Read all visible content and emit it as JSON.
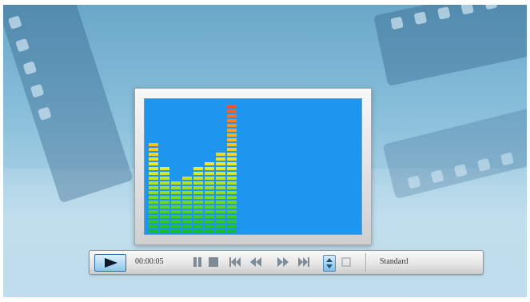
{
  "player": {
    "time": "00:00:05",
    "mode_label": "Standard"
  },
  "controls": [
    {
      "name": "play-button",
      "icon": "play-icon"
    },
    {
      "name": "pause-button",
      "icon": "pause-icon"
    },
    {
      "name": "stop-button",
      "icon": "stop-icon"
    },
    {
      "name": "previous-button",
      "icon": "skip-back-icon"
    },
    {
      "name": "rewind-button",
      "icon": "rewind-icon"
    },
    {
      "name": "fast-forward-button",
      "icon": "fast-forward-icon"
    },
    {
      "name": "next-button",
      "icon": "skip-forward-icon"
    },
    {
      "name": "volume-button",
      "icon": "volume-updown-icon"
    },
    {
      "name": "fullscreen-button",
      "icon": "fullscreen-icon"
    }
  ],
  "visualizer": {
    "levels": [
      0.72,
      0.52,
      0.42,
      0.46,
      0.5,
      0.56,
      0.62,
      1.0
    ]
  },
  "colors": {
    "screen": "#1e95ee",
    "accent": "#2b6fa8"
  }
}
